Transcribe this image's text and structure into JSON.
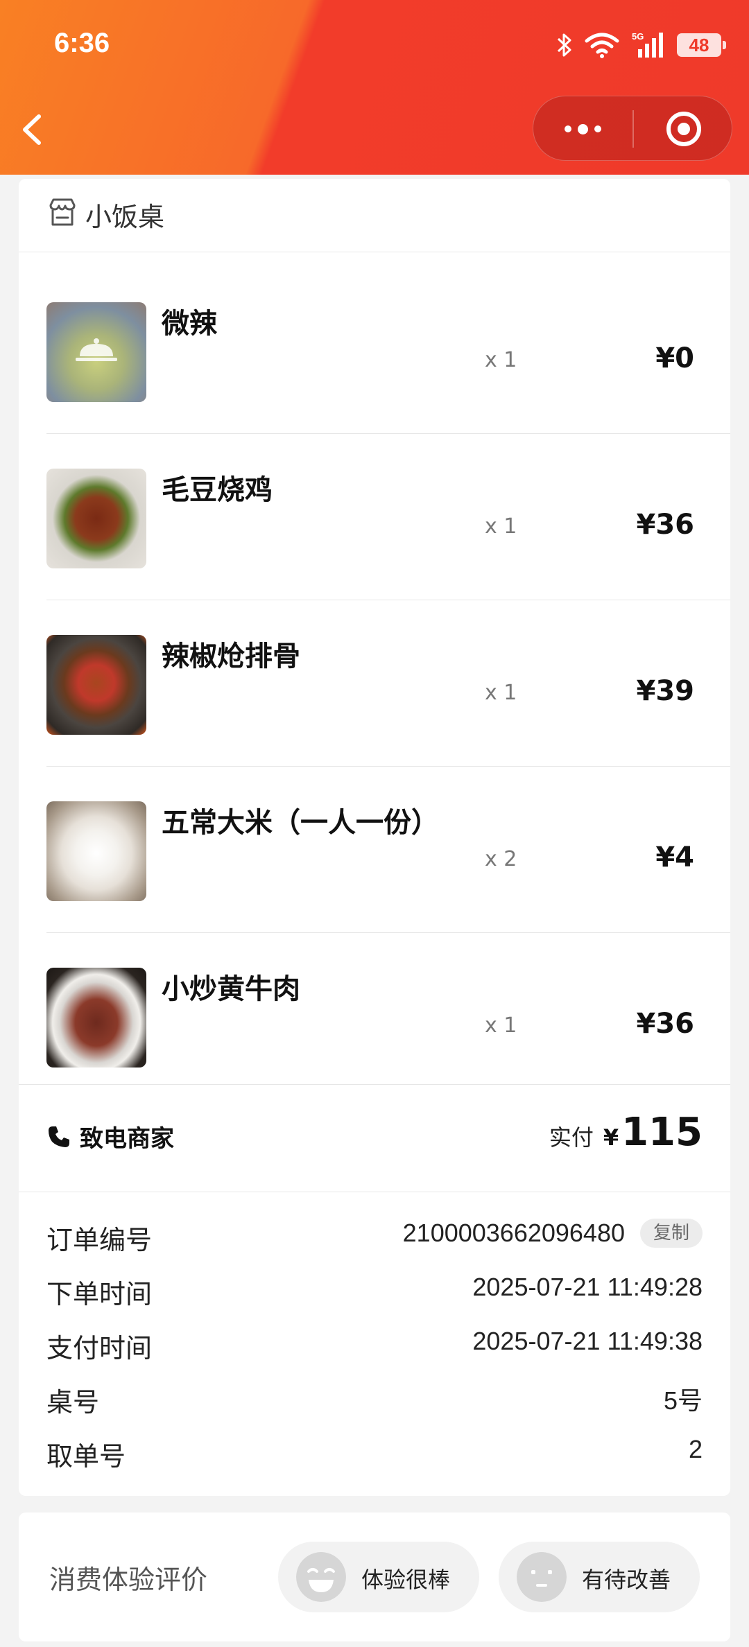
{
  "status_bar": {
    "time": "6:36",
    "battery": "48"
  },
  "shop": {
    "name": "小饭桌"
  },
  "items": [
    {
      "name": "微辣",
      "qty": "x 1",
      "price": "¥0"
    },
    {
      "name": "毛豆烧鸡",
      "qty": "x 1",
      "price": "¥36"
    },
    {
      "name": "辣椒炝排骨",
      "qty": "x 1",
      "price": "¥39"
    },
    {
      "name": "五常大米（一人一份）",
      "qty": "x 2",
      "price": "¥4"
    },
    {
      "name": "小炒黄牛肉",
      "qty": "x 1",
      "price": "¥36"
    }
  ],
  "call": {
    "label": "致电商家"
  },
  "payment": {
    "label": "实付",
    "currency": "¥",
    "amount": "115"
  },
  "order_info": {
    "order_no": {
      "label": "订单编号",
      "value": "2100003662096480",
      "copy": "复制"
    },
    "order_time": {
      "label": "下单时间",
      "value": "2025-07-21 11:49:28"
    },
    "pay_time": {
      "label": "支付时间",
      "value": "2025-07-21 11:49:38"
    },
    "table": {
      "label": "桌号",
      "value": "5号"
    },
    "pickup": {
      "label": "取单号",
      "value": "2"
    }
  },
  "rating": {
    "label": "消费体验评价",
    "good": "体验很棒",
    "improve": "有待改善"
  },
  "colors": {
    "header_start": "#f98024",
    "header_end": "#ef3a2a"
  }
}
